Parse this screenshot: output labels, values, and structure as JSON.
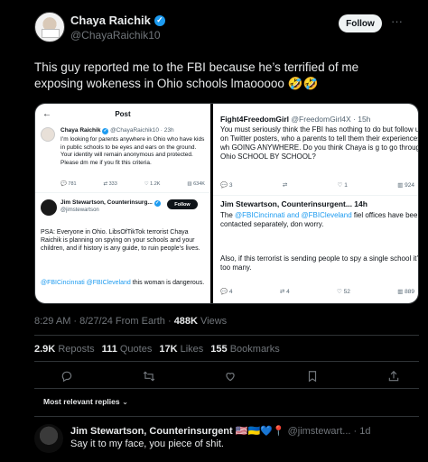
{
  "header": {
    "name": "Chaya Raichik",
    "handle": "@ChayaRaichik10",
    "follow_label": "Follow",
    "more": "···"
  },
  "tweet": {
    "text": "This guy reported me to the FBI because he’s terrified of me exposing wokeness in Ohio schools lmaooooo 🤣🤣"
  },
  "media": {
    "left": {
      "back": "←",
      "title": "Post",
      "post1_name": "Chaya Raichik",
      "post1_meta": "@ChayaRaichik10 · 23h",
      "post1_body": "I’m looking for parents anywhere in Ohio who have kids in public schools to be eyes and ears on the ground. Your identity will remain anonymous and protected. Please dm me if you fit this criteria.",
      "post1_stats": [
        "781",
        "333",
        "1.2K",
        "634K"
      ],
      "post2_name": "Jim Stewartson, Counterinsurg...",
      "post2_handle": "@jimstewartson",
      "post2_follow": "Follow",
      "post2_body": "PSA: Everyone in Ohio. LibsOfTikTok terrorist Chaya Raichik is planning on spying on your schools and your children, and if history is any guide, to ruin people’s lives.",
      "post2_link": "@FBICincinnati @FBICleveland",
      "post2_tail": " this woman is dangerous."
    },
    "right": {
      "post1_name": "Fight4FreedomGirl",
      "post1_meta": "@FreedomGirl4X · 15h",
      "post1_body": "You must seriously think the FBI has nothing to do but follow up on Twitter posters, who a parents to tell them their experiences -- wh GOING ANYWHERE. Do you think Chaya is g to go through Ohio SCHOOL BY SCHOOL?",
      "post1_stats": [
        "3",
        "",
        "1",
        "924"
      ],
      "post2_name": "Jim Stewartson, Counterinsurgent... 14h",
      "post2_body_a": "The ",
      "post2_link": "@FBICincinnati and @FBICleveland",
      "post2_body_b": " fiel offices have been contacted separately, don worry.",
      "post2_body2": "Also, if this terrorist is sending people to spy a single school it’s too many.",
      "post2_stats": [
        "4",
        "4",
        "52",
        "889"
      ]
    }
  },
  "meta": {
    "time": "8:29 AM · 8/27/24 From Earth · ",
    "views_count": "488K",
    "views_label": " Views"
  },
  "stats": {
    "reposts_count": "2.9K",
    "reposts_label": "Reposts",
    "quotes_count": "111",
    "quotes_label": "Quotes",
    "likes_count": "17K",
    "likes_label": "Likes",
    "bookmarks_count": "155",
    "bookmarks_label": "Bookmarks"
  },
  "replies": {
    "sort_label": "Most relevant replies",
    "reply1": {
      "name": "Jim Stewartson, Counterinsurgent 🇺🇸🇺🇦💙📍",
      "handle": " @jimstewart... · 1d",
      "text": "Say it to my face, you piece of shit."
    }
  },
  "colors": {
    "background": "#000000",
    "accent": "#1d9bf0",
    "text": "#e7e9ea",
    "muted": "#71767b"
  }
}
